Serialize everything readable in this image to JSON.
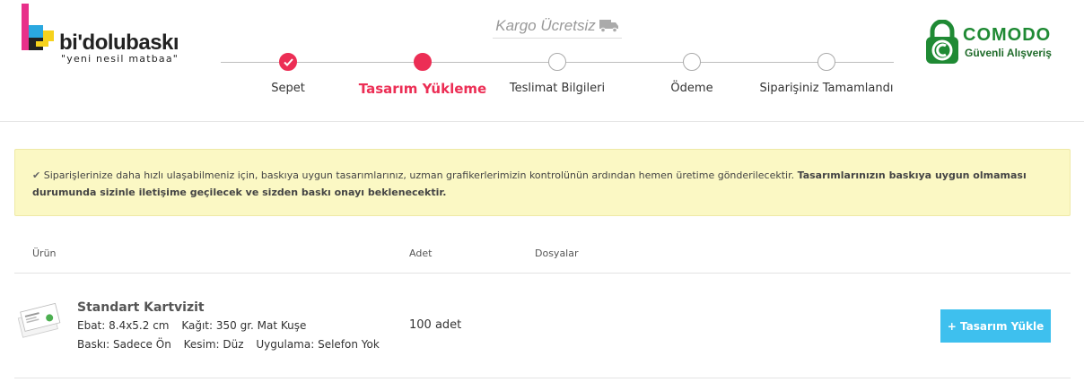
{
  "brand": {
    "name": "bi'dolubaskı",
    "tagline": "\"yeni nesil matbaa\""
  },
  "shipping": {
    "label": "Kargo Ücretsiz",
    "icon": "truck-icon"
  },
  "steps": [
    {
      "label": "Sepet",
      "state": "done"
    },
    {
      "label": "Tasarım Yükleme",
      "state": "active"
    },
    {
      "label": "Teslimat Bilgileri",
      "state": "pending"
    },
    {
      "label": "Ödeme",
      "state": "pending"
    },
    {
      "label": "Siparişiniz Tamamlandı",
      "state": "pending"
    }
  ],
  "security": {
    "title": "COMODO",
    "subtitle": "Güvenli Alışveriş"
  },
  "notice": {
    "icon": "check-icon",
    "text": "Siparişlerinize daha hızlı ulaşabilmeniz için, baskıya uygun tasarımlarınız, uzman grafikerlerimizin kontrolünün ardından hemen üretime gönderilecektir.",
    "bold": "Tasarımlarınızın baskıya uygun olmaması durumunda sizinle iletişime geçilecek ve sizden baskı onayı beklenecektir."
  },
  "table": {
    "headers": {
      "product": "Ürün",
      "quantity": "Adet",
      "files": "Dosyalar"
    },
    "rows": [
      {
        "name": "Standart Kartvizit",
        "specs_line1": [
          "Ebat: 8.4x5.2 cm",
          "Kağıt: 350 gr. Mat Kuşe"
        ],
        "specs_line2": [
          "Baskı: Sadece Ön",
          "Kesim: Düz",
          "Uygulama: Selefon Yok"
        ],
        "quantity": "100 adet",
        "upload_label": "+ Tasarım Yükle"
      }
    ]
  },
  "colors": {
    "accent": "#ec2e55",
    "button": "#3ec0ee",
    "notice_bg": "#fbf8c4",
    "comodo_green": "#1f8a34"
  }
}
